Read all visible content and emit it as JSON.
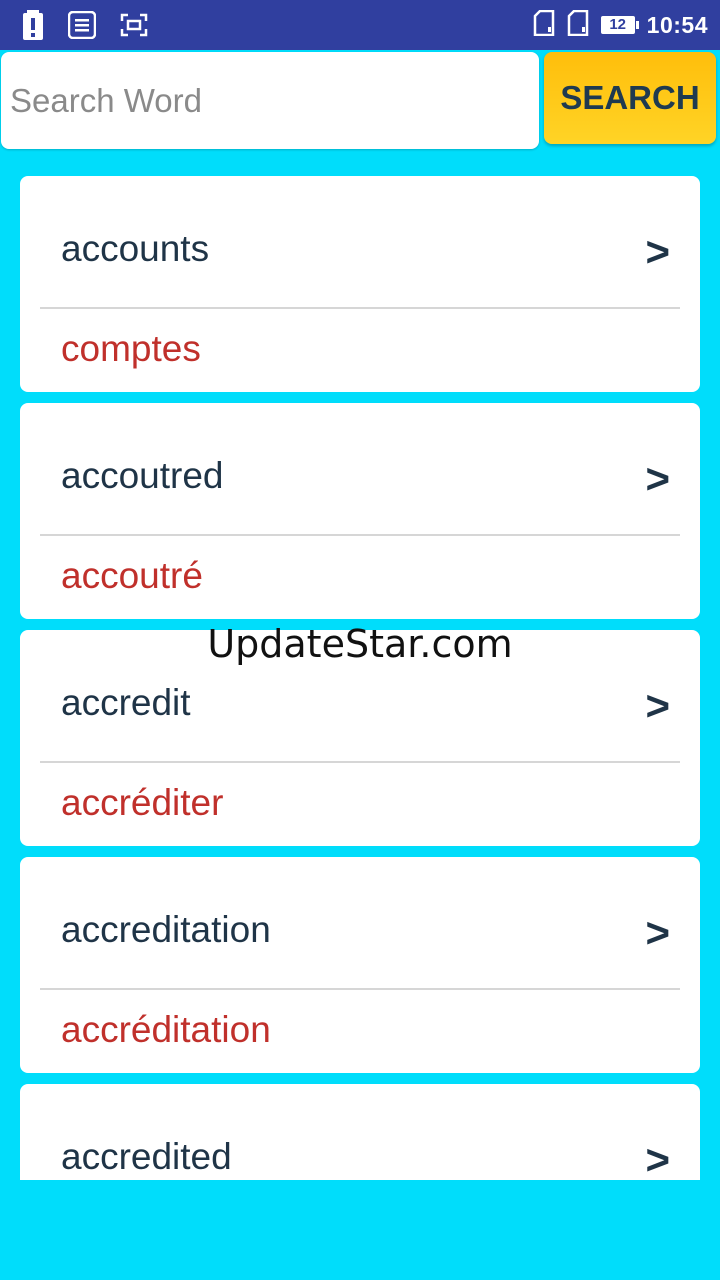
{
  "status_bar": {
    "time": "10:54",
    "battery_level": "12",
    "left_icons": [
      "alert-icon",
      "notes-icon",
      "screenshot-icon"
    ],
    "right_icons": [
      "sim-card-icon",
      "sim-card-icon",
      "battery-icon"
    ]
  },
  "search": {
    "placeholder": "Search Word",
    "value": "",
    "button_label": "SEARCH"
  },
  "entries": [
    {
      "word": "accounts",
      "translation": "comptes"
    },
    {
      "word": "accoutred",
      "translation": "accoutré"
    },
    {
      "word": "accredit",
      "translation": "accréditer"
    },
    {
      "word": "accreditation",
      "translation": "accréditation"
    },
    {
      "word": "accredited",
      "translation": ""
    }
  ],
  "chevron": ">",
  "watermark": "UpdateStar.com",
  "colors": {
    "status_bar": "#303F9F",
    "background": "#00DDFB",
    "search_button": "#FFC61A",
    "word_text": "#1F3447",
    "translation_text": "#C0302B"
  }
}
